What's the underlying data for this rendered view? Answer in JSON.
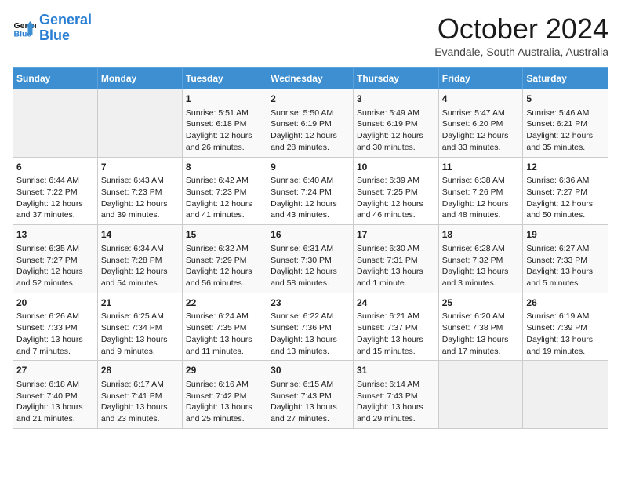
{
  "header": {
    "logo_line1": "General",
    "logo_line2": "Blue",
    "month_title": "October 2024",
    "subtitle": "Evandale, South Australia, Australia"
  },
  "days_of_week": [
    "Sunday",
    "Monday",
    "Tuesday",
    "Wednesday",
    "Thursday",
    "Friday",
    "Saturday"
  ],
  "weeks": [
    [
      {
        "day": "",
        "info": ""
      },
      {
        "day": "",
        "info": ""
      },
      {
        "day": "1",
        "info": "Sunrise: 5:51 AM\nSunset: 6:18 PM\nDaylight: 12 hours\nand 26 minutes."
      },
      {
        "day": "2",
        "info": "Sunrise: 5:50 AM\nSunset: 6:19 PM\nDaylight: 12 hours\nand 28 minutes."
      },
      {
        "day": "3",
        "info": "Sunrise: 5:49 AM\nSunset: 6:19 PM\nDaylight: 12 hours\nand 30 minutes."
      },
      {
        "day": "4",
        "info": "Sunrise: 5:47 AM\nSunset: 6:20 PM\nDaylight: 12 hours\nand 33 minutes."
      },
      {
        "day": "5",
        "info": "Sunrise: 5:46 AM\nSunset: 6:21 PM\nDaylight: 12 hours\nand 35 minutes."
      }
    ],
    [
      {
        "day": "6",
        "info": "Sunrise: 6:44 AM\nSunset: 7:22 PM\nDaylight: 12 hours\nand 37 minutes."
      },
      {
        "day": "7",
        "info": "Sunrise: 6:43 AM\nSunset: 7:23 PM\nDaylight: 12 hours\nand 39 minutes."
      },
      {
        "day": "8",
        "info": "Sunrise: 6:42 AM\nSunset: 7:23 PM\nDaylight: 12 hours\nand 41 minutes."
      },
      {
        "day": "9",
        "info": "Sunrise: 6:40 AM\nSunset: 7:24 PM\nDaylight: 12 hours\nand 43 minutes."
      },
      {
        "day": "10",
        "info": "Sunrise: 6:39 AM\nSunset: 7:25 PM\nDaylight: 12 hours\nand 46 minutes."
      },
      {
        "day": "11",
        "info": "Sunrise: 6:38 AM\nSunset: 7:26 PM\nDaylight: 12 hours\nand 48 minutes."
      },
      {
        "day": "12",
        "info": "Sunrise: 6:36 AM\nSunset: 7:27 PM\nDaylight: 12 hours\nand 50 minutes."
      }
    ],
    [
      {
        "day": "13",
        "info": "Sunrise: 6:35 AM\nSunset: 7:27 PM\nDaylight: 12 hours\nand 52 minutes."
      },
      {
        "day": "14",
        "info": "Sunrise: 6:34 AM\nSunset: 7:28 PM\nDaylight: 12 hours\nand 54 minutes."
      },
      {
        "day": "15",
        "info": "Sunrise: 6:32 AM\nSunset: 7:29 PM\nDaylight: 12 hours\nand 56 minutes."
      },
      {
        "day": "16",
        "info": "Sunrise: 6:31 AM\nSunset: 7:30 PM\nDaylight: 12 hours\nand 58 minutes."
      },
      {
        "day": "17",
        "info": "Sunrise: 6:30 AM\nSunset: 7:31 PM\nDaylight: 13 hours\nand 1 minute."
      },
      {
        "day": "18",
        "info": "Sunrise: 6:28 AM\nSunset: 7:32 PM\nDaylight: 13 hours\nand 3 minutes."
      },
      {
        "day": "19",
        "info": "Sunrise: 6:27 AM\nSunset: 7:33 PM\nDaylight: 13 hours\nand 5 minutes."
      }
    ],
    [
      {
        "day": "20",
        "info": "Sunrise: 6:26 AM\nSunset: 7:33 PM\nDaylight: 13 hours\nand 7 minutes."
      },
      {
        "day": "21",
        "info": "Sunrise: 6:25 AM\nSunset: 7:34 PM\nDaylight: 13 hours\nand 9 minutes."
      },
      {
        "day": "22",
        "info": "Sunrise: 6:24 AM\nSunset: 7:35 PM\nDaylight: 13 hours\nand 11 minutes."
      },
      {
        "day": "23",
        "info": "Sunrise: 6:22 AM\nSunset: 7:36 PM\nDaylight: 13 hours\nand 13 minutes."
      },
      {
        "day": "24",
        "info": "Sunrise: 6:21 AM\nSunset: 7:37 PM\nDaylight: 13 hours\nand 15 minutes."
      },
      {
        "day": "25",
        "info": "Sunrise: 6:20 AM\nSunset: 7:38 PM\nDaylight: 13 hours\nand 17 minutes."
      },
      {
        "day": "26",
        "info": "Sunrise: 6:19 AM\nSunset: 7:39 PM\nDaylight: 13 hours\nand 19 minutes."
      }
    ],
    [
      {
        "day": "27",
        "info": "Sunrise: 6:18 AM\nSunset: 7:40 PM\nDaylight: 13 hours\nand 21 minutes."
      },
      {
        "day": "28",
        "info": "Sunrise: 6:17 AM\nSunset: 7:41 PM\nDaylight: 13 hours\nand 23 minutes."
      },
      {
        "day": "29",
        "info": "Sunrise: 6:16 AM\nSunset: 7:42 PM\nDaylight: 13 hours\nand 25 minutes."
      },
      {
        "day": "30",
        "info": "Sunrise: 6:15 AM\nSunset: 7:43 PM\nDaylight: 13 hours\nand 27 minutes."
      },
      {
        "day": "31",
        "info": "Sunrise: 6:14 AM\nSunset: 7:43 PM\nDaylight: 13 hours\nand 29 minutes."
      },
      {
        "day": "",
        "info": ""
      },
      {
        "day": "",
        "info": ""
      }
    ]
  ]
}
